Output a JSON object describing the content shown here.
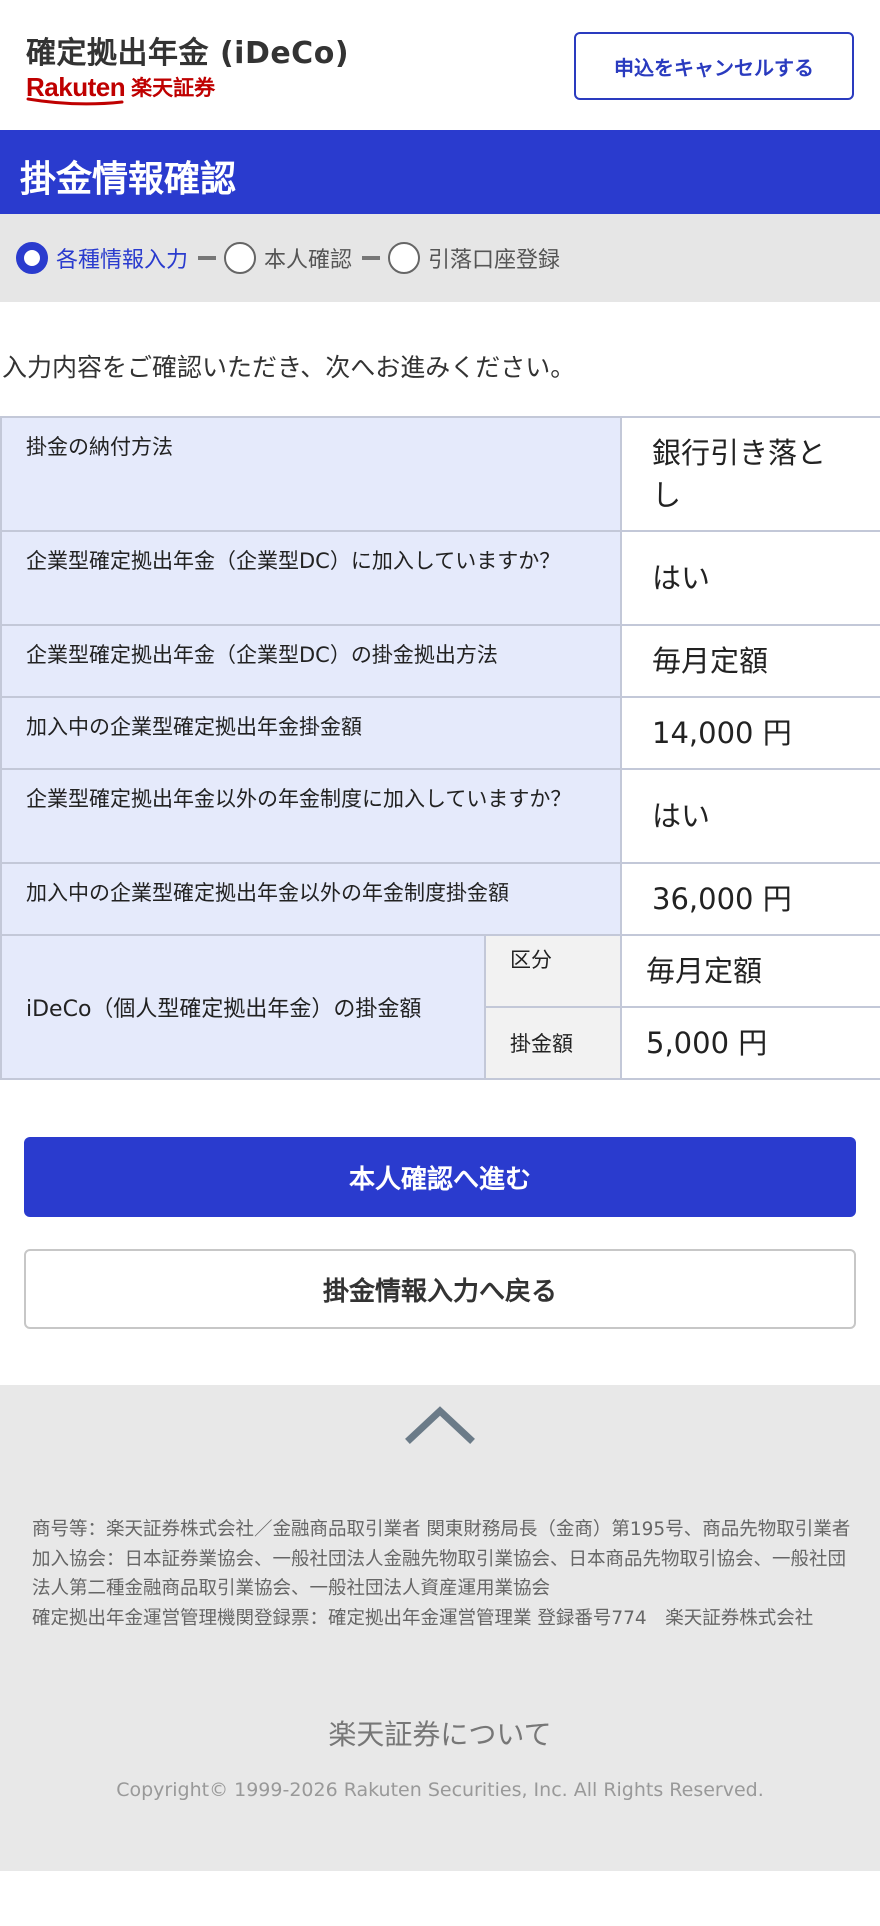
{
  "header": {
    "app_title": "確定拠出年金 (iDeCo)",
    "brand_word": "Rakuten",
    "brand_jp": "楽天証券",
    "cancel_label": "申込をキャンセルする",
    "brand_color": "#bf0000"
  },
  "title_bar": {
    "title": "掛金情報確認",
    "color": "#2a3bce"
  },
  "steps": [
    {
      "label": "各種情報入力",
      "active": true
    },
    {
      "label": "本人確認",
      "active": false
    },
    {
      "label": "引落口座登録",
      "active": false
    }
  ],
  "instruction": "入力内容をご確認いただき、次へお進みください。",
  "table": {
    "rows": [
      {
        "label": "掛金の納付方法",
        "value": "銀行引き落とし"
      },
      {
        "label": "企業型確定拠出年金（企業型DC）に加入していますか？",
        "value": "はい"
      },
      {
        "label": "企業型確定拠出年金（企業型DC）の掛金拠出方法",
        "value": "毎月定額"
      },
      {
        "label": "加入中の企業型確定拠出年金掛金額",
        "value": "14,000 円"
      },
      {
        "label": "企業型確定拠出年金以外の年金制度に加入していますか？",
        "value": "はい"
      },
      {
        "label": "加入中の企業型確定拠出年金以外の年金制度掛金額",
        "value": "36,000 円"
      }
    ],
    "ideco": {
      "label": "iDeCo（個人型確定拠出年金）の掛金額",
      "division_label": "区分",
      "division_value": "毎月定額",
      "amount_label": "掛金額",
      "amount_value": "5,000 円"
    }
  },
  "buttons": {
    "next_label": "本人確認へ進む",
    "back_label": "掛金情報入力へ戻る"
  },
  "footer": {
    "scroll_top_icon": "chevron-up-icon",
    "lines": [
      "商号等：楽天証券株式会社／金融商品取引業者 関東財務局長（金商）第195号、商品先物取引業者",
      "加入協会：日本証券業協会、一般社団法人金融先物取引業協会、日本商品先物取引協会、一般社団法人第二種金融商品取引業協会、一般社団法人資産運用業協会",
      "確定拠出年金運営管理機関登録票：確定拠出年金運営管理業 登録番号774　楽天証券株式会社"
    ],
    "about_link": "楽天証券について",
    "copyright": "Copyright© 1999-2026 Rakuten Securities, Inc. All Rights Reserved."
  }
}
